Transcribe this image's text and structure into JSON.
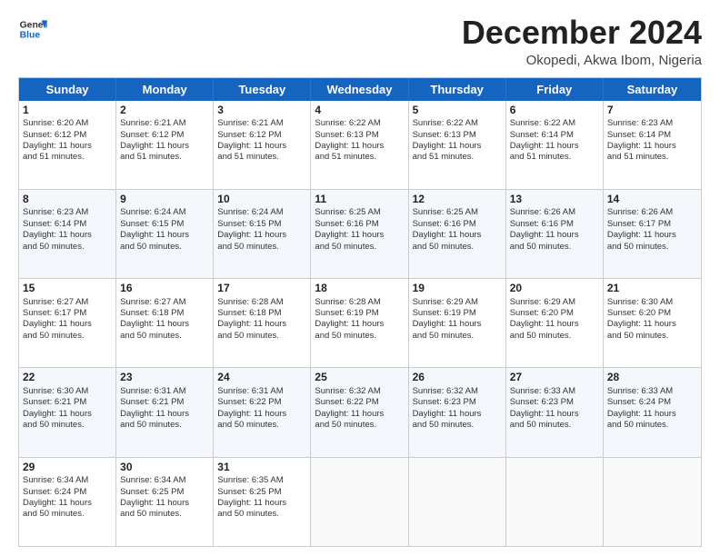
{
  "logo": {
    "line1": "General",
    "line2": "Blue"
  },
  "title": "December 2024",
  "location": "Okopedi, Akwa Ibom, Nigeria",
  "weekdays": [
    "Sunday",
    "Monday",
    "Tuesday",
    "Wednesday",
    "Thursday",
    "Friday",
    "Saturday"
  ],
  "rows": [
    [
      {
        "day": "1",
        "lines": [
          "Sunrise: 6:20 AM",
          "Sunset: 6:12 PM",
          "Daylight: 11 hours",
          "and 51 minutes."
        ]
      },
      {
        "day": "2",
        "lines": [
          "Sunrise: 6:21 AM",
          "Sunset: 6:12 PM",
          "Daylight: 11 hours",
          "and 51 minutes."
        ]
      },
      {
        "day": "3",
        "lines": [
          "Sunrise: 6:21 AM",
          "Sunset: 6:12 PM",
          "Daylight: 11 hours",
          "and 51 minutes."
        ]
      },
      {
        "day": "4",
        "lines": [
          "Sunrise: 6:22 AM",
          "Sunset: 6:13 PM",
          "Daylight: 11 hours",
          "and 51 minutes."
        ]
      },
      {
        "day": "5",
        "lines": [
          "Sunrise: 6:22 AM",
          "Sunset: 6:13 PM",
          "Daylight: 11 hours",
          "and 51 minutes."
        ]
      },
      {
        "day": "6",
        "lines": [
          "Sunrise: 6:22 AM",
          "Sunset: 6:14 PM",
          "Daylight: 11 hours",
          "and 51 minutes."
        ]
      },
      {
        "day": "7",
        "lines": [
          "Sunrise: 6:23 AM",
          "Sunset: 6:14 PM",
          "Daylight: 11 hours",
          "and 51 minutes."
        ]
      }
    ],
    [
      {
        "day": "8",
        "lines": [
          "Sunrise: 6:23 AM",
          "Sunset: 6:14 PM",
          "Daylight: 11 hours",
          "and 50 minutes."
        ]
      },
      {
        "day": "9",
        "lines": [
          "Sunrise: 6:24 AM",
          "Sunset: 6:15 PM",
          "Daylight: 11 hours",
          "and 50 minutes."
        ]
      },
      {
        "day": "10",
        "lines": [
          "Sunrise: 6:24 AM",
          "Sunset: 6:15 PM",
          "Daylight: 11 hours",
          "and 50 minutes."
        ]
      },
      {
        "day": "11",
        "lines": [
          "Sunrise: 6:25 AM",
          "Sunset: 6:16 PM",
          "Daylight: 11 hours",
          "and 50 minutes."
        ]
      },
      {
        "day": "12",
        "lines": [
          "Sunrise: 6:25 AM",
          "Sunset: 6:16 PM",
          "Daylight: 11 hours",
          "and 50 minutes."
        ]
      },
      {
        "day": "13",
        "lines": [
          "Sunrise: 6:26 AM",
          "Sunset: 6:16 PM",
          "Daylight: 11 hours",
          "and 50 minutes."
        ]
      },
      {
        "day": "14",
        "lines": [
          "Sunrise: 6:26 AM",
          "Sunset: 6:17 PM",
          "Daylight: 11 hours",
          "and 50 minutes."
        ]
      }
    ],
    [
      {
        "day": "15",
        "lines": [
          "Sunrise: 6:27 AM",
          "Sunset: 6:17 PM",
          "Daylight: 11 hours",
          "and 50 minutes."
        ]
      },
      {
        "day": "16",
        "lines": [
          "Sunrise: 6:27 AM",
          "Sunset: 6:18 PM",
          "Daylight: 11 hours",
          "and 50 minutes."
        ]
      },
      {
        "day": "17",
        "lines": [
          "Sunrise: 6:28 AM",
          "Sunset: 6:18 PM",
          "Daylight: 11 hours",
          "and 50 minutes."
        ]
      },
      {
        "day": "18",
        "lines": [
          "Sunrise: 6:28 AM",
          "Sunset: 6:19 PM",
          "Daylight: 11 hours",
          "and 50 minutes."
        ]
      },
      {
        "day": "19",
        "lines": [
          "Sunrise: 6:29 AM",
          "Sunset: 6:19 PM",
          "Daylight: 11 hours",
          "and 50 minutes."
        ]
      },
      {
        "day": "20",
        "lines": [
          "Sunrise: 6:29 AM",
          "Sunset: 6:20 PM",
          "Daylight: 11 hours",
          "and 50 minutes."
        ]
      },
      {
        "day": "21",
        "lines": [
          "Sunrise: 6:30 AM",
          "Sunset: 6:20 PM",
          "Daylight: 11 hours",
          "and 50 minutes."
        ]
      }
    ],
    [
      {
        "day": "22",
        "lines": [
          "Sunrise: 6:30 AM",
          "Sunset: 6:21 PM",
          "Daylight: 11 hours",
          "and 50 minutes."
        ]
      },
      {
        "day": "23",
        "lines": [
          "Sunrise: 6:31 AM",
          "Sunset: 6:21 PM",
          "Daylight: 11 hours",
          "and 50 minutes."
        ]
      },
      {
        "day": "24",
        "lines": [
          "Sunrise: 6:31 AM",
          "Sunset: 6:22 PM",
          "Daylight: 11 hours",
          "and 50 minutes."
        ]
      },
      {
        "day": "25",
        "lines": [
          "Sunrise: 6:32 AM",
          "Sunset: 6:22 PM",
          "Daylight: 11 hours",
          "and 50 minutes."
        ]
      },
      {
        "day": "26",
        "lines": [
          "Sunrise: 6:32 AM",
          "Sunset: 6:23 PM",
          "Daylight: 11 hours",
          "and 50 minutes."
        ]
      },
      {
        "day": "27",
        "lines": [
          "Sunrise: 6:33 AM",
          "Sunset: 6:23 PM",
          "Daylight: 11 hours",
          "and 50 minutes."
        ]
      },
      {
        "day": "28",
        "lines": [
          "Sunrise: 6:33 AM",
          "Sunset: 6:24 PM",
          "Daylight: 11 hours",
          "and 50 minutes."
        ]
      }
    ],
    [
      {
        "day": "29",
        "lines": [
          "Sunrise: 6:34 AM",
          "Sunset: 6:24 PM",
          "Daylight: 11 hours",
          "and 50 minutes."
        ]
      },
      {
        "day": "30",
        "lines": [
          "Sunrise: 6:34 AM",
          "Sunset: 6:25 PM",
          "Daylight: 11 hours",
          "and 50 minutes."
        ]
      },
      {
        "day": "31",
        "lines": [
          "Sunrise: 6:35 AM",
          "Sunset: 6:25 PM",
          "Daylight: 11 hours",
          "and 50 minutes."
        ]
      },
      {
        "day": "",
        "lines": []
      },
      {
        "day": "",
        "lines": []
      },
      {
        "day": "",
        "lines": []
      },
      {
        "day": "",
        "lines": []
      }
    ]
  ]
}
